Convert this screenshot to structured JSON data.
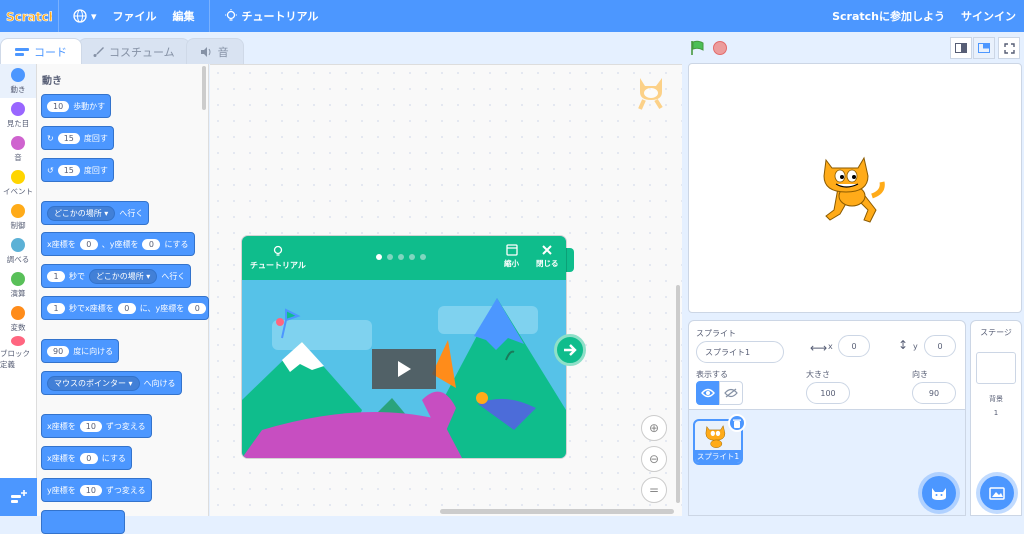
{
  "menubar": {
    "logo": "Scratch",
    "file": "ファイル",
    "edit": "編集",
    "tutorials": "チュートリアル",
    "join": "Scratchに参加しよう",
    "signin": "サインイン"
  },
  "tabs": {
    "code": "コード",
    "costumes": "コスチューム",
    "sounds": "音"
  },
  "categories": [
    {
      "label": "動き",
      "color": "#4c97ff"
    },
    {
      "label": "見た目",
      "color": "#9966ff"
    },
    {
      "label": "音",
      "color": "#cf63cf"
    },
    {
      "label": "イベント",
      "color": "#ffd500"
    },
    {
      "label": "制御",
      "color": "#ffab19"
    },
    {
      "label": "調べる",
      "color": "#5cb1d6"
    },
    {
      "label": "演算",
      "color": "#59c059"
    },
    {
      "label": "変数",
      "color": "#ff8c1a"
    },
    {
      "label": "ブロック定義",
      "color": "#ff6680"
    }
  ],
  "palette": {
    "title": "動き",
    "move_num": "10",
    "move_label": "歩動かす",
    "turn_right_num": "15",
    "turn_right_label": "度回す",
    "turn_left_num": "15",
    "turn_left_label": "度回す",
    "goto_drop": "どこかの場所",
    "goto_label": "へ行く",
    "gotoxy_x_label": "x座標を",
    "gotoxy_x": "0",
    "gotoxy_y_label": "、y座標を",
    "gotoxy_y": "0",
    "gotoxy_tail": "にする",
    "glide_num": "1",
    "glide_label": "秒で",
    "glide_drop": "どこかの場所",
    "glide_tail": "へ行く",
    "glidexy_num": "1",
    "glidexy_label": "秒でx座標を",
    "glidexy_x": "0",
    "glidexy_mid": "に、y座標を",
    "glidexy_y": "0",
    "point_num": "90",
    "point_label": "度に向ける",
    "pointto_drop": "マウスのポインター",
    "pointto_label": "へ向ける",
    "changex_label": "x座標を",
    "changex_num": "10",
    "changex_tail": "ずつ変える",
    "setx_label": "x座標を",
    "setx_num": "0",
    "setx_tail": "にする",
    "changey_label": "y座標を",
    "changey_num": "10",
    "changey_tail": "ずつ変える"
  },
  "tutorial": {
    "title": "チュートリアル",
    "shrink": "縮小",
    "close": "閉じる",
    "steps": 5,
    "current_step": 1
  },
  "sprite_info": {
    "sprite_label": "スプライト",
    "sprite_name": "スプライト1",
    "x_label": "x",
    "x_value": "0",
    "y_label": "y",
    "y_value": "0",
    "show_label": "表示する",
    "size_label": "大きさ",
    "size_value": "100",
    "direction_label": "向き",
    "direction_value": "90"
  },
  "sprite_list": {
    "items": [
      {
        "name": "スプライト1"
      }
    ]
  },
  "stage_pane": {
    "title": "ステージ",
    "backdrops_label": "背景",
    "backdrops_count": "1"
  }
}
